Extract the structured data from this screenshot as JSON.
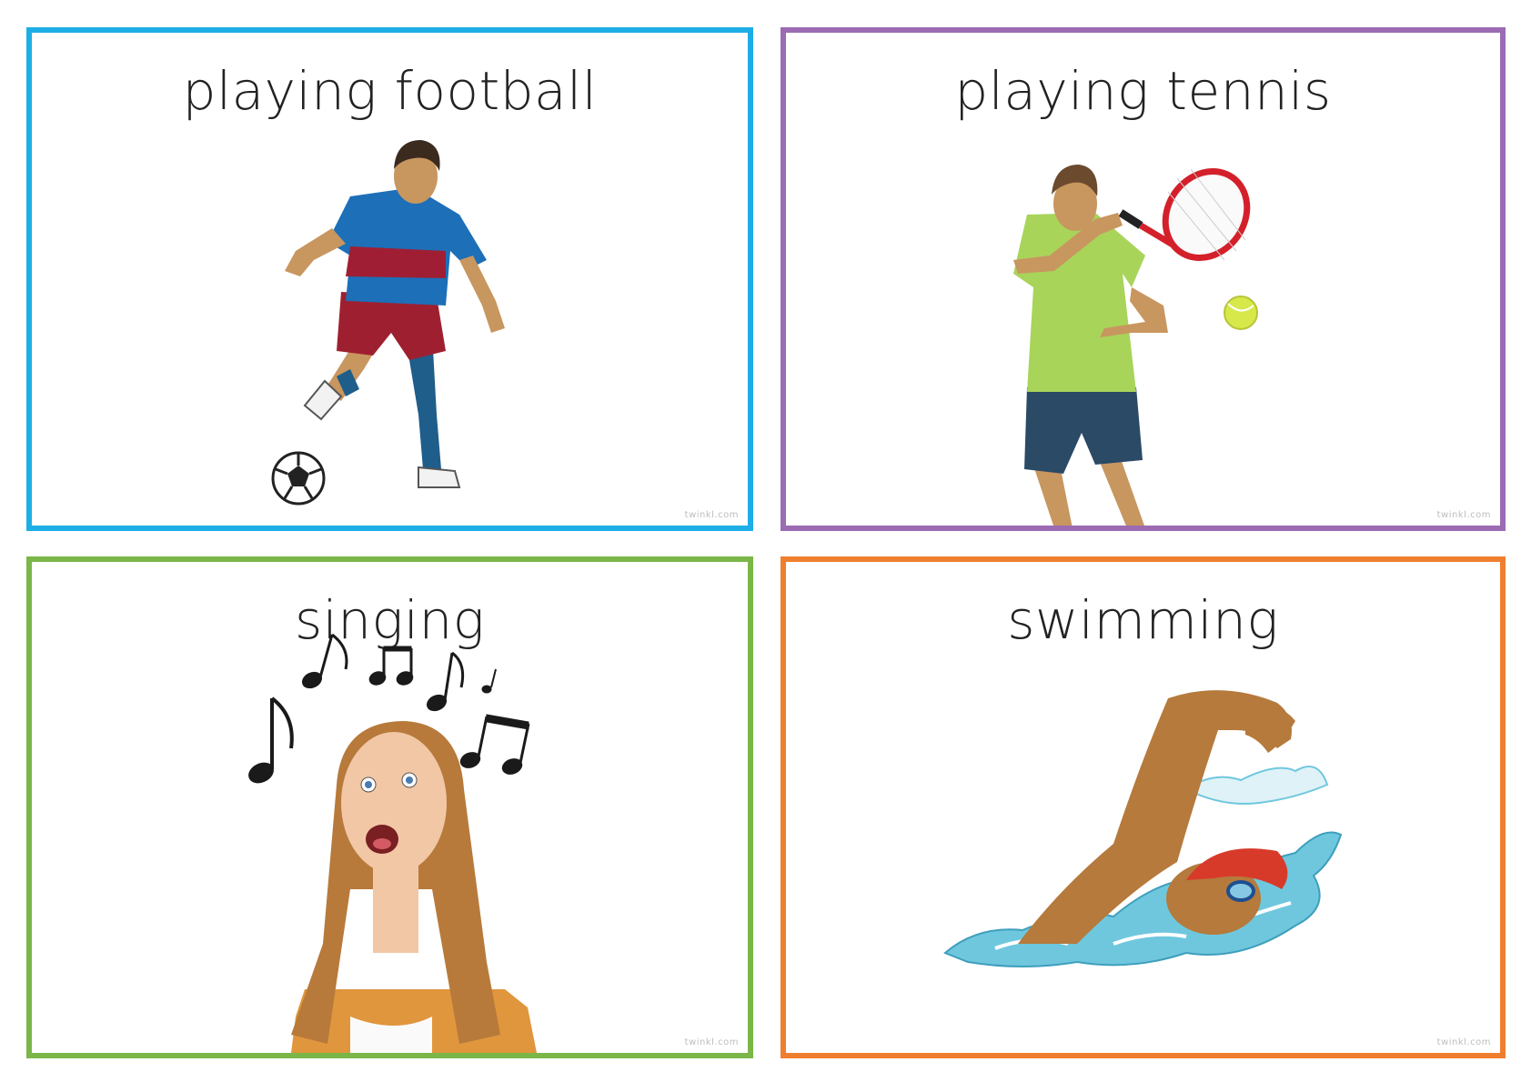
{
  "cards": [
    {
      "title": "playing football",
      "watermark": "twinkl.com",
      "border_color": "#1eaee6",
      "illustration": "footballer-kicking-ball"
    },
    {
      "title": "playing tennis",
      "watermark": "twinkl.com",
      "border_color": "#9b6bb3",
      "illustration": "tennis-player-with-racket"
    },
    {
      "title": "singing",
      "watermark": "twinkl.com",
      "border_color": "#7ab648",
      "illustration": "girl-singing-with-music-notes"
    },
    {
      "title": "swimming",
      "watermark": "twinkl.com",
      "border_color": "#ef7f2e",
      "illustration": "swimmer-front-crawl"
    }
  ]
}
